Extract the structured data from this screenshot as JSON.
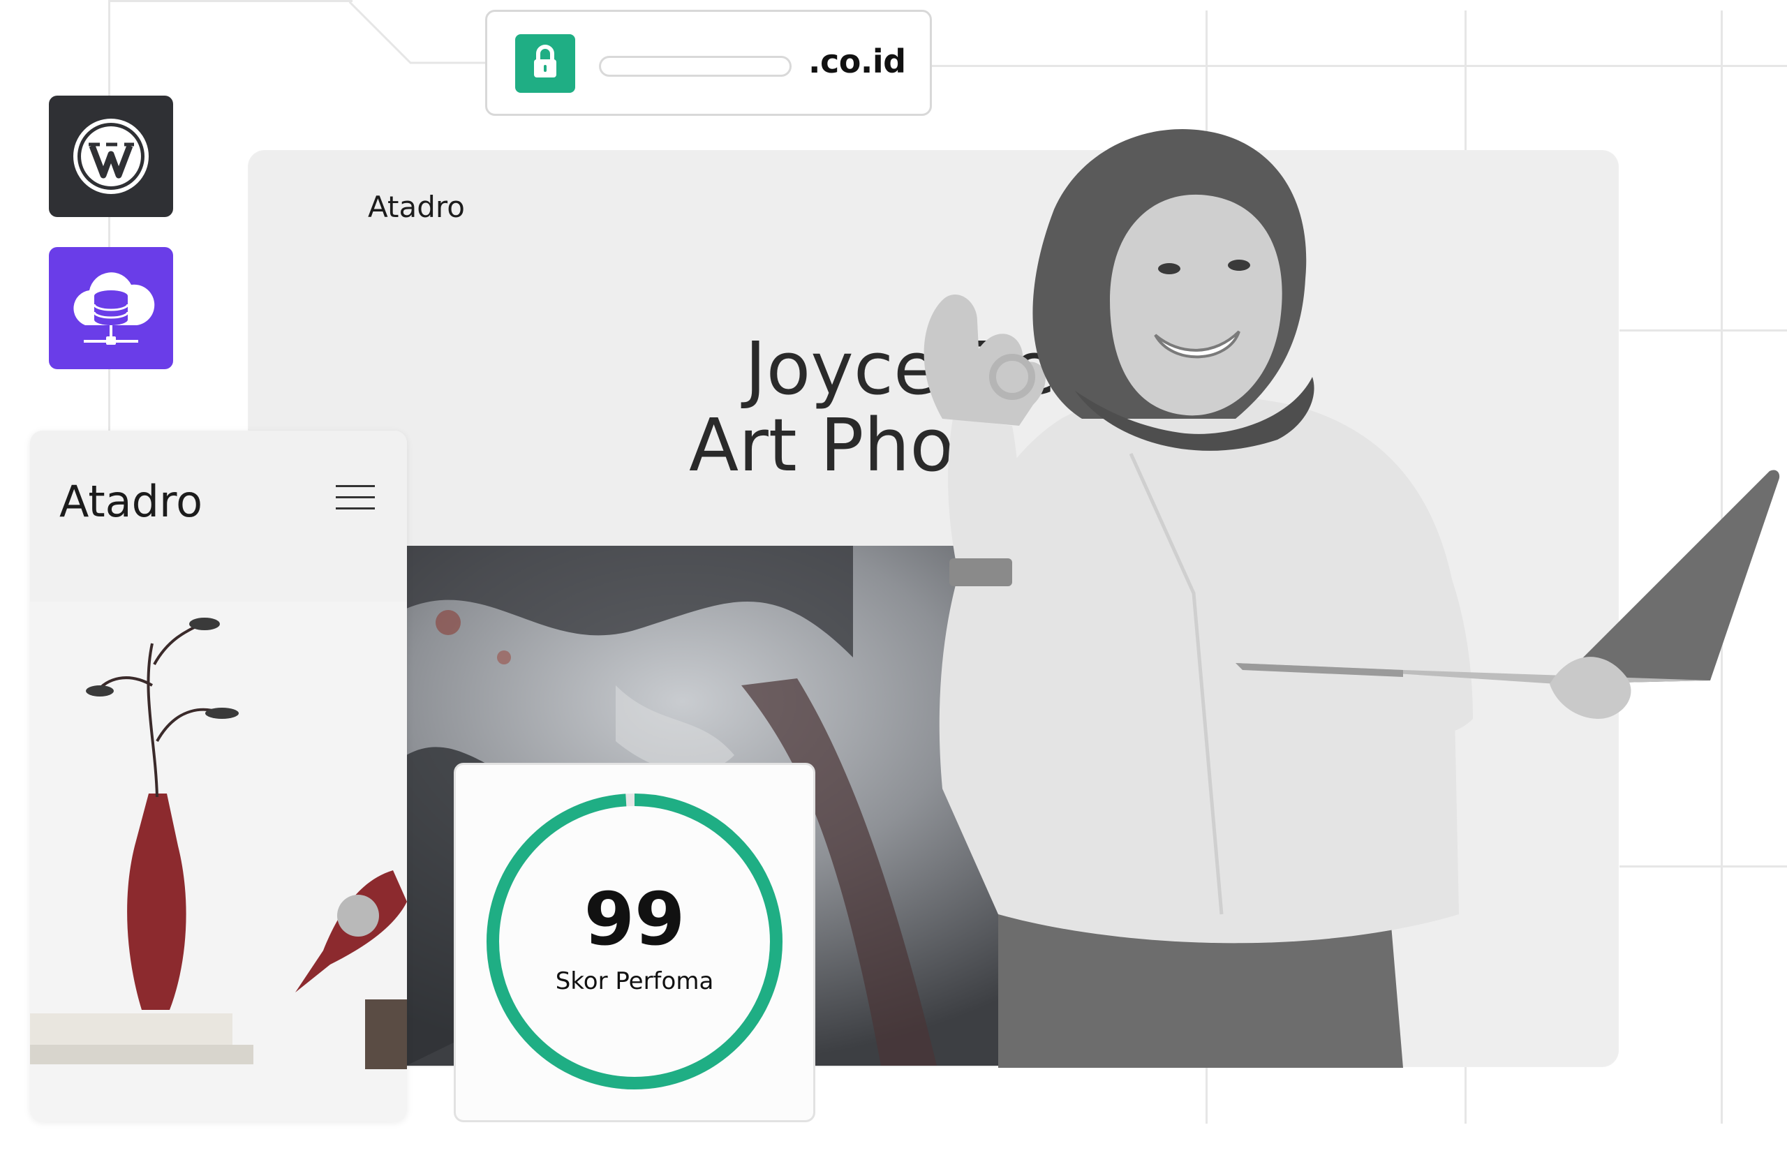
{
  "address_bar": {
    "domain_suffix": ".co.id",
    "lock_icon": "lock-icon"
  },
  "apps": [
    {
      "name": "wordpress",
      "icon": "wordpress-icon",
      "color": "#2f3034"
    },
    {
      "name": "cloud-hosting",
      "icon": "cloud-database-icon",
      "color": "#6a3de8"
    }
  ],
  "desktop_preview": {
    "brand": "Atadro",
    "hero_line1": "Joyce Be",
    "hero_line2": "Art Pho"
  },
  "mobile_preview": {
    "brand": "Atadro",
    "menu_icon": "hamburger-menu-icon"
  },
  "score_card": {
    "value": "99",
    "label": "Skor Perfoma",
    "progress": 0.99,
    "ring_color": "#1fae84"
  },
  "colors": {
    "accent_green": "#1fae84",
    "purple": "#6a3de8",
    "dark_tile": "#2f3034"
  }
}
